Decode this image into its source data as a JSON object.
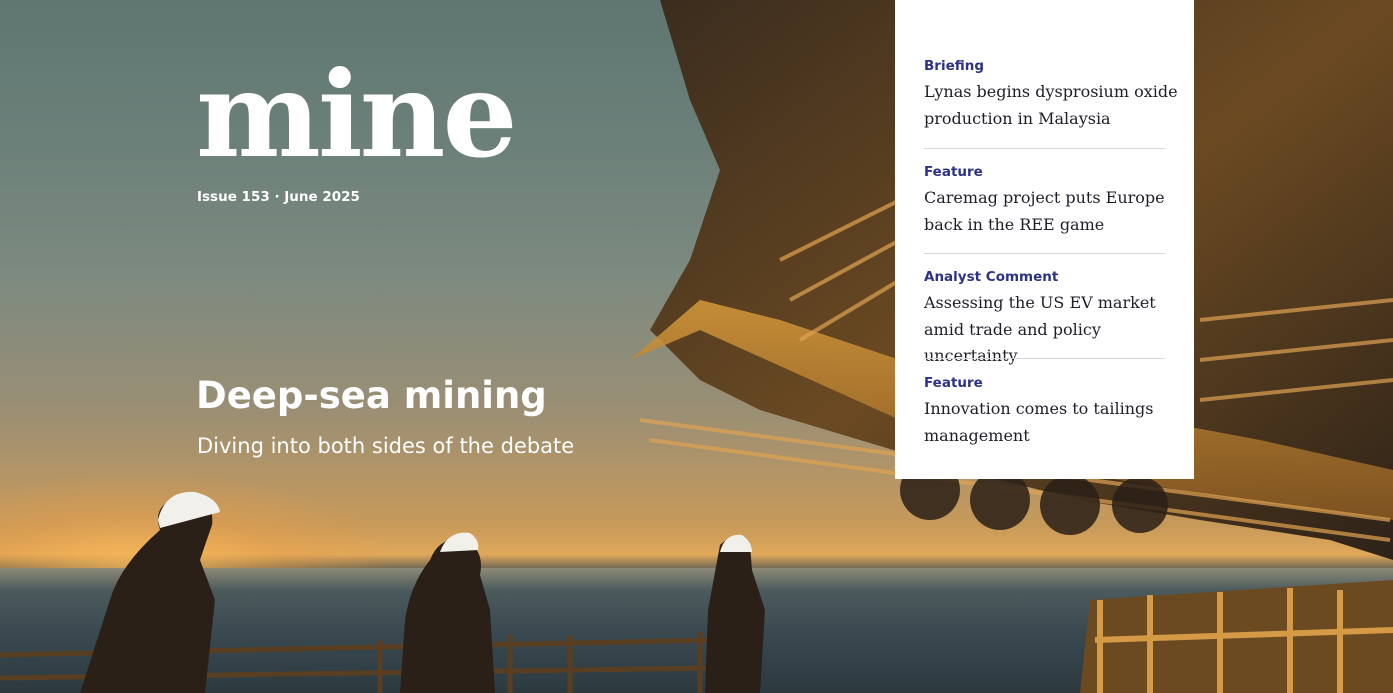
{
  "masthead": {
    "logo": "mine",
    "issue": "Issue 153 · June 2025"
  },
  "cover_story": {
    "headline": "Deep-sea mining",
    "subheadline": "Diving into both sides of the debate"
  },
  "contents": [
    {
      "category": "Briefing",
      "title": "Lynas begins dysprosium oxide production in Malaysia"
    },
    {
      "category": "Feature",
      "title": "Caremag project puts Europe back in the REE game"
    },
    {
      "category": "Analyst Comment",
      "title": "Assessing the US EV market amid trade and policy uncertainty"
    },
    {
      "category": "Feature",
      "title": "Innovation comes to tailings management"
    }
  ],
  "colors": {
    "category": "#2c3284",
    "panel_bg": "#ffffff",
    "text_dark": "#1e1e28"
  }
}
